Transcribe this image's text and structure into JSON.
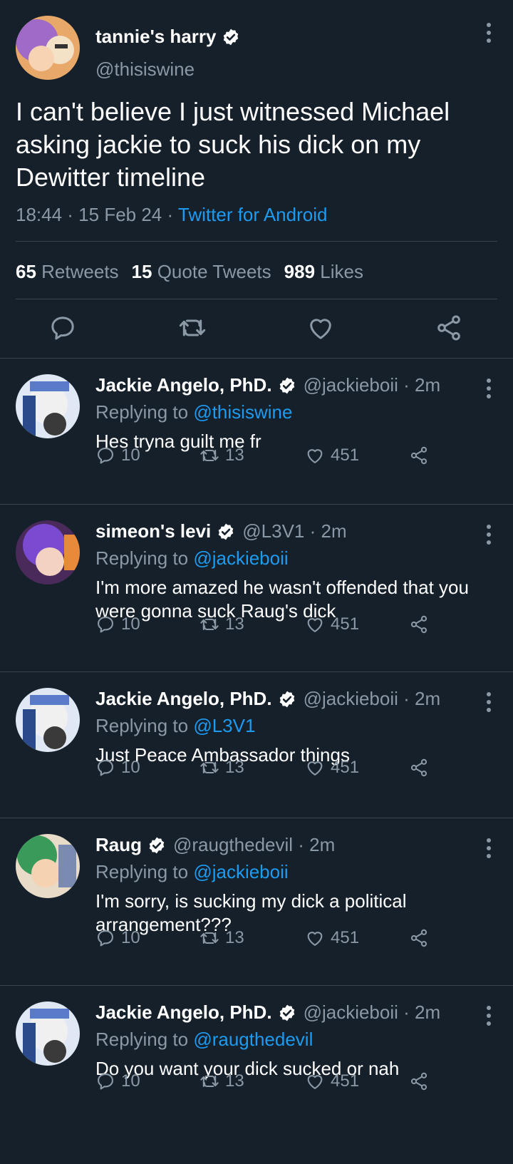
{
  "colors": {
    "background": "#15202b",
    "text": "#ffffff",
    "muted": "#8b98a5",
    "link": "#1d9bf0",
    "divider": "#38444d"
  },
  "main_tweet": {
    "display_name": "tannie's harry",
    "handle": "@thisiswine",
    "text": "I can't believe I just witnessed Michael asking jackie to suck his dick on my Dewitter timeline",
    "time": "18:44 · 15 Feb 24 · ",
    "source": "Twitter for Android",
    "retweets_count": "65",
    "retweets_label": "Retweets",
    "quotes_count": "15",
    "quotes_label": "Quote Tweets",
    "likes_count": "989",
    "likes_label": "Likes",
    "icons": [
      "reply-icon",
      "retweet-icon",
      "like-icon",
      "share-icon"
    ]
  },
  "replies": [
    {
      "display_name": "Jackie Angelo, PhD.",
      "handle": "@jackieboii · 2m",
      "replying_prefix": "Replying to ",
      "replying_to": "@thisiswine",
      "text": "Hes tryna guilt me fr",
      "reply_count": "10",
      "retweet_count": "13",
      "like_count": "451"
    },
    {
      "display_name": "simeon's levi",
      "handle": "@L3V1 · 2m",
      "replying_prefix": "Replying to ",
      "replying_to": "@jackieboii",
      "text": "I'm more amazed he wasn't offended that you were gonna suck Raug's dick",
      "reply_count": "10",
      "retweet_count": "13",
      "like_count": "451"
    },
    {
      "display_name": "Jackie Angelo, PhD.",
      "handle": "@jackieboii · 2m",
      "replying_prefix": "Replying to ",
      "replying_to": "@L3V1",
      "text": "Just Peace Ambassador things",
      "reply_count": "10",
      "retweet_count": "13",
      "like_count": "451"
    },
    {
      "display_name": "Raug",
      "handle": "@raugthedevil · 2m",
      "replying_prefix": "Replying to ",
      "replying_to": "@jackieboii",
      "text": "I'm sorry, is sucking my dick a political arrangement???",
      "reply_count": "10",
      "retweet_count": "13",
      "like_count": "451"
    },
    {
      "display_name": "Jackie Angelo, PhD.",
      "handle": "@jackieboii · 2m",
      "replying_prefix": "Replying to ",
      "replying_to": "@raugthedevil",
      "text": "Do you want your dick sucked or nah",
      "reply_count": "10",
      "retweet_count": "13",
      "like_count": "451"
    }
  ]
}
